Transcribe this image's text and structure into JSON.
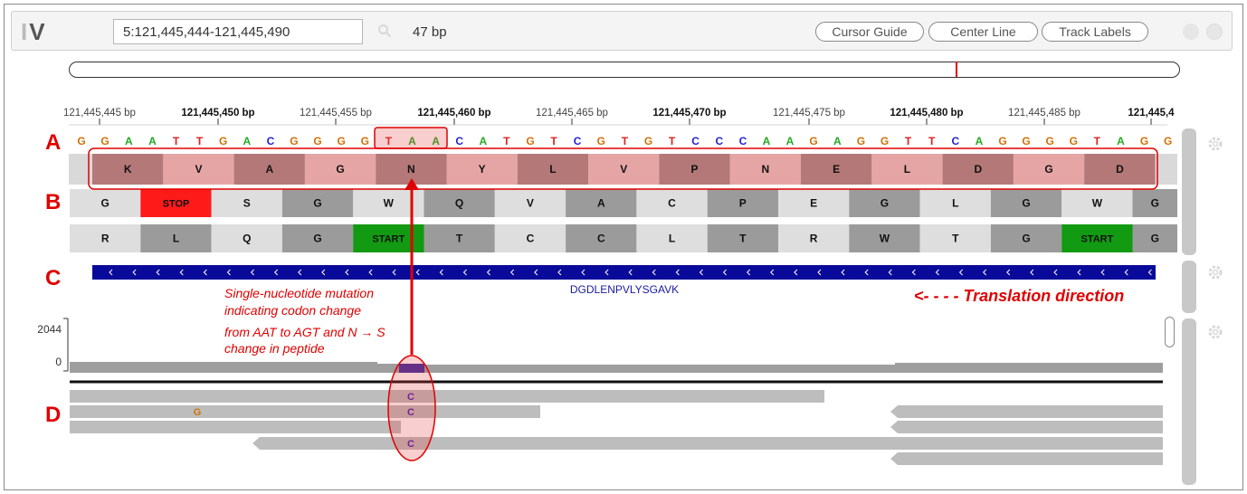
{
  "app": {
    "logo_main": "I",
    "logo_tail": "V"
  },
  "locus": {
    "value": "5:121,445,444-121,445,490"
  },
  "bp_count": "47 bp",
  "header_buttons": {
    "cursor_guide": "Cursor Guide",
    "center_line": "Center Line",
    "track_labels": "Track Labels"
  },
  "ruler": {
    "ticks": [
      {
        "label": "121,445,445 bp",
        "bold": false
      },
      {
        "label": "121,445,450 bp",
        "bold": true
      },
      {
        "label": "121,445,455 bp",
        "bold": false
      },
      {
        "label": "121,445,460 bp",
        "bold": true
      },
      {
        "label": "121,445,465 bp",
        "bold": false
      },
      {
        "label": "121,445,470 bp",
        "bold": true
      },
      {
        "label": "121,445,475 bp",
        "bold": false
      },
      {
        "label": "121,445,480 bp",
        "bold": true
      },
      {
        "label": "121,445,485 bp",
        "bold": false
      },
      {
        "label": "121,445,4",
        "bold": true
      }
    ]
  },
  "sequence": [
    "G",
    "G",
    "A",
    "A",
    "T",
    "T",
    "G",
    "A",
    "C",
    "G",
    "G",
    "G",
    "G",
    "T",
    "A",
    "A",
    "C",
    "A",
    "T",
    "G",
    "T",
    "C",
    "G",
    "T",
    "G",
    "T",
    "C",
    "C",
    "C",
    "A",
    "A",
    "G",
    "A",
    "G",
    "G",
    "T",
    "T",
    "C",
    "A",
    "G",
    "G",
    "G",
    "G",
    "T",
    "A",
    "G",
    "G"
  ],
  "base_colors": {
    "A": "#22aa22",
    "C": "#2222dd",
    "G": "#d17105",
    "T": "#dd2222"
  },
  "translation": {
    "frame1": [
      "K",
      "V",
      "A",
      "G",
      "N",
      "Y",
      "L",
      "V",
      "P",
      "N",
      "E",
      "L",
      "D",
      "G",
      "D"
    ],
    "frame2": [
      "G",
      "STOP",
      "S",
      "G",
      "W",
      "Q",
      "V",
      "A",
      "C",
      "P",
      "E",
      "G",
      "L",
      "G",
      "W",
      "G"
    ],
    "frame3": [
      "R",
      "L",
      "Q",
      "G",
      "START",
      "T",
      "C",
      "C",
      "L",
      "T",
      "R",
      "W",
      "T",
      "G",
      "START",
      "G"
    ]
  },
  "peptide_track": {
    "label": "DGDLENPVLYSGAVK"
  },
  "coverage": {
    "max": "2044",
    "min": "0"
  },
  "reads": {
    "mismatch_A": "C",
    "mismatch_B": "C",
    "mismatch_C": "C",
    "mismatch_G": "G"
  },
  "annotations": {
    "label_a": "A",
    "label_b": "B",
    "label_c": "C",
    "label_d": "D",
    "mutation_line1": "Single-nucleotide mutation",
    "mutation_line2": "indicating codon change",
    "mutation_line3": "from AAT to AGT and N → S",
    "mutation_line4": "change in peptide",
    "translation_direction": "<- - - - Translation  direction"
  },
  "colors": {
    "accent_red": "#e00000",
    "peptide_blue": "#0a0a9a",
    "stop_red": "#ff1a1a",
    "start_green": "#129a12",
    "frame1_dark": "#b47878",
    "frame1_light": "#e6a5a5"
  }
}
